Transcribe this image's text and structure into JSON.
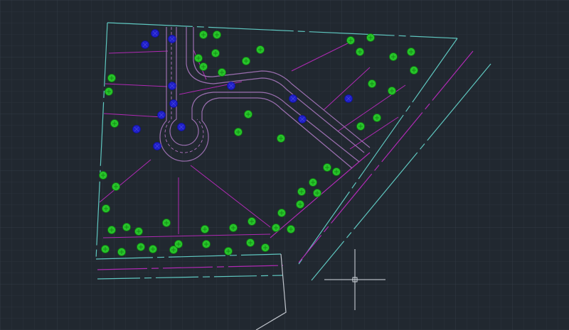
{
  "app": {
    "kind": "cad-drawing-viewport"
  },
  "colors": {
    "background": "#212830",
    "grid_minor": "#2a323b",
    "grid_major": "#313a44",
    "boundary": "#5fc7c0",
    "lot_lines": "#b02ab4",
    "road": "#9b6fb0",
    "tree": "#27c42a",
    "tree_outline": "#0f7d10",
    "light": "#2020c8",
    "light_outline": "#1010a0",
    "crosshair": "#d8dde3"
  },
  "symbols": {
    "tree": "tree-symbol",
    "light": "street-light-symbol"
  },
  "tree_count": 58,
  "light_count": 13,
  "crosshair": {
    "visible": true
  }
}
